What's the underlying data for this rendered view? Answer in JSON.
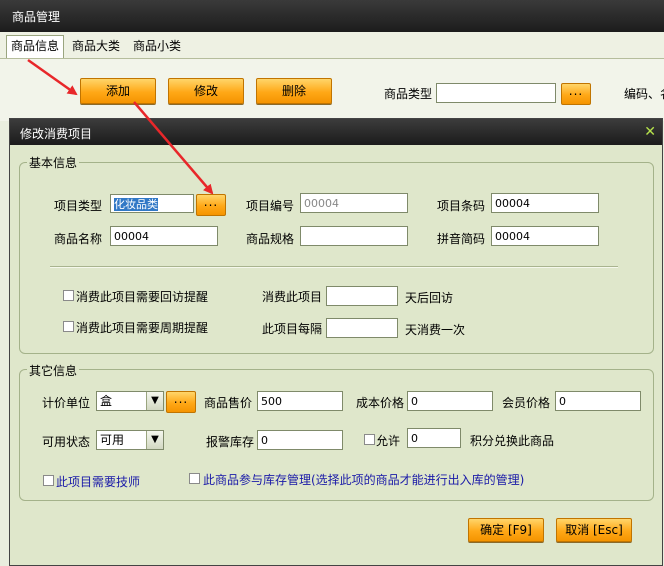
{
  "window": {
    "title": "商品管理"
  },
  "tabs": [
    "商品信息",
    "商品大类",
    "商品小类"
  ],
  "toolbar": {
    "add": "添加",
    "edit": "修改",
    "delete": "删除",
    "type_label": "商品类型",
    "type_value": "",
    "browse": "...",
    "trailing": "编码、名"
  },
  "dialog": {
    "title": "修改消费项目",
    "basic": {
      "title": "基本信息",
      "item_type_label": "项目类型",
      "item_type_value": "化妆品类",
      "browse": "...",
      "item_code_label": "项目编号",
      "item_code_value": "00004",
      "item_barcode_label": "项目条码",
      "item_barcode_value": "00004",
      "name_label": "商品名称",
      "name_value": "00004",
      "spec_label": "商品规格",
      "spec_value": "",
      "pinyin_label": "拼音简码",
      "pinyin_value": "00004",
      "revisit_check": "消费此项目需要回访提醒",
      "revisit_prefix": "消费此项目",
      "revisit_value": "",
      "revisit_suffix": "天后回访",
      "cycle_check": "消费此项目需要周期提醒",
      "cycle_prefix": "此项目每隔",
      "cycle_value": "",
      "cycle_suffix": "天消费一次"
    },
    "other": {
      "title": "其它信息",
      "unit_label": "计价单位",
      "unit_value": "盒",
      "browse": "...",
      "price_label": "商品售价",
      "price_value": "500",
      "cost_label": "成本价格",
      "cost_value": "0",
      "member_label": "会员价格",
      "member_value": "0",
      "status_label": "可用状态",
      "status_value": "可用",
      "stock_label": "报警库存",
      "stock_value": "0",
      "allow_label": "允许",
      "allow_value": "0",
      "points_label": "积分兑换此商品",
      "tech_check": "此项目需要技师",
      "inventory_check": "此商品参与库存管理(选择此项的商品才能进行出入库的管理)"
    },
    "ok": "确定 [F9]",
    "cancel": "取消 [Esc]"
  }
}
